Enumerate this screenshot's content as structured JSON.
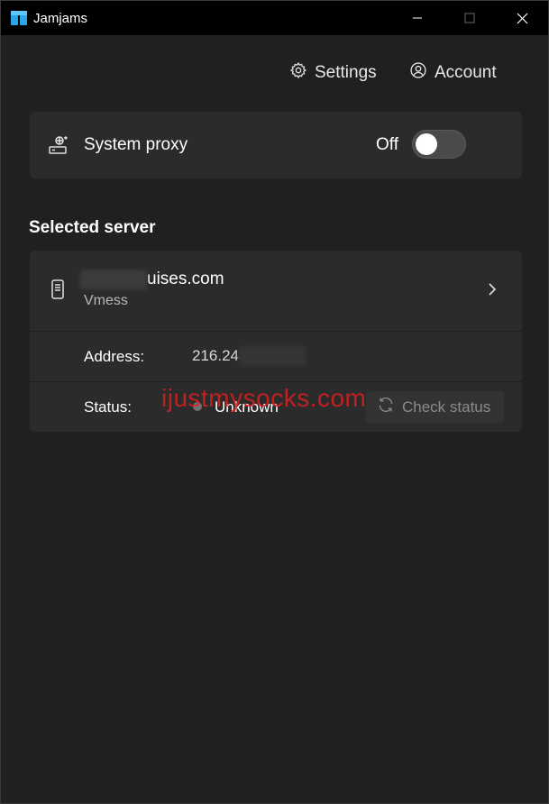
{
  "window": {
    "title": "Jamjams"
  },
  "nav": {
    "settings_label": "Settings",
    "account_label": "Account"
  },
  "proxy": {
    "label": "System proxy",
    "state_label": "Off",
    "enabled": false
  },
  "selected_server": {
    "section_title": "Selected server",
    "host_visible": "uises.com",
    "protocol": "Vmess",
    "address_label": "Address:",
    "address_visible": "216.24",
    "status_label": "Status:",
    "status_value": "Unknown",
    "check_status_label": "Check status"
  },
  "watermark": "ijustmysocks.com",
  "icons": {
    "app": "app-logo-icon",
    "settings": "gear-icon",
    "account": "user-circle-icon",
    "proxy": "proxy-network-icon",
    "server": "phone-device-icon",
    "chevron": "chevron-right-icon",
    "refresh": "refresh-icon"
  },
  "colors": {
    "background": "#202020",
    "card": "#2b2b2b",
    "titlebar": "#000000",
    "watermark": "#dc1e1e",
    "status_dot": "#707070"
  }
}
